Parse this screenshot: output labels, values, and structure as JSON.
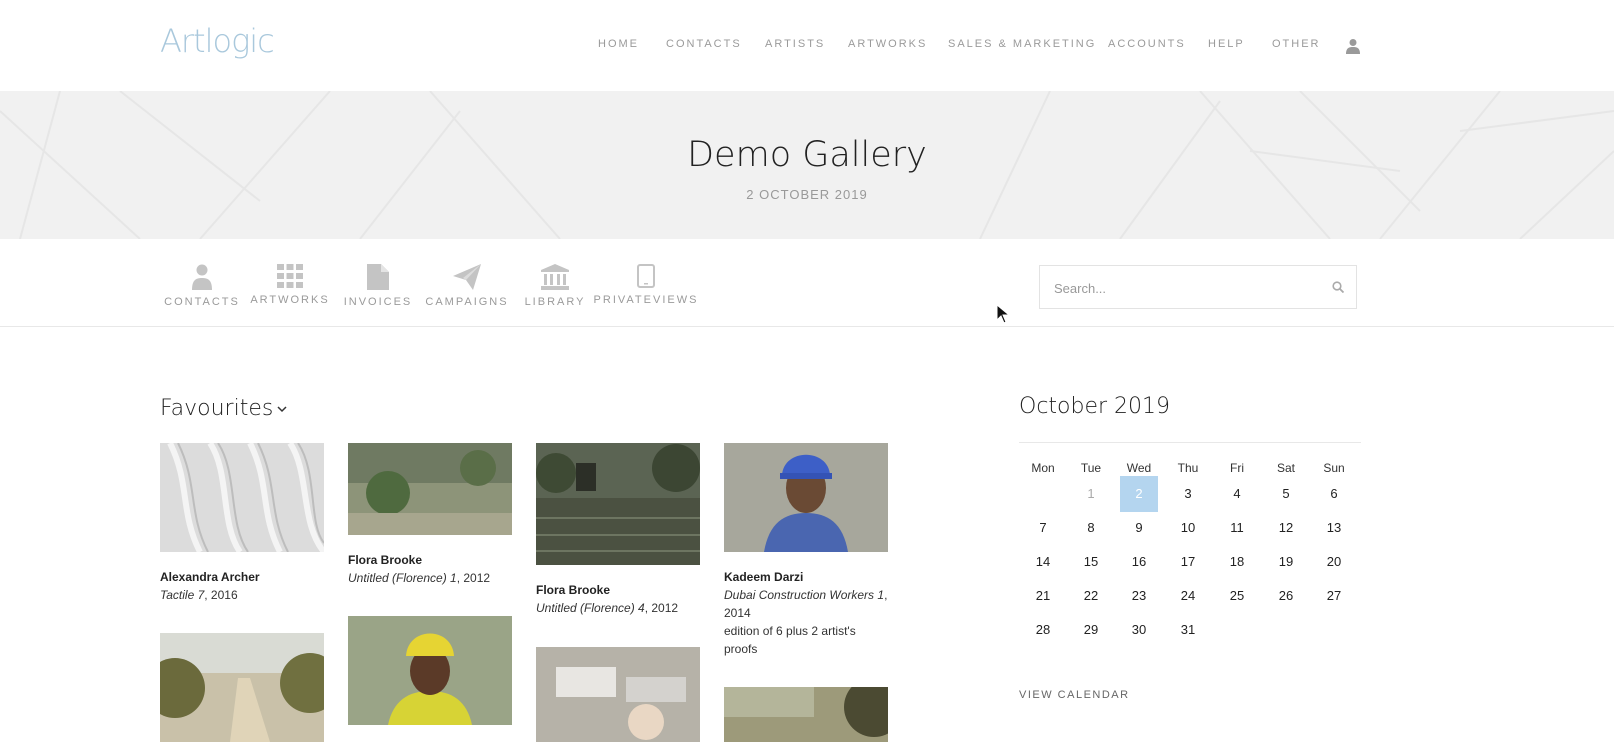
{
  "brand": {
    "logo": "Artlogic"
  },
  "nav": {
    "items": [
      "HOME",
      "CONTACTS",
      "ARTISTS",
      "ARTWORKS",
      "SALES & MARKETING",
      "ACCOUNTS",
      "HELP",
      "OTHER"
    ],
    "user_icon": "user-icon"
  },
  "banner": {
    "title": "Demo Gallery",
    "date": "2 OCTOBER 2019"
  },
  "quick_links": [
    {
      "label": "CONTACTS",
      "icon": "person-icon"
    },
    {
      "label": "ARTWORKS",
      "icon": "grid-icon"
    },
    {
      "label": "INVOICES",
      "icon": "document-icon"
    },
    {
      "label": "CAMPAIGNS",
      "icon": "paper-plane-icon"
    },
    {
      "label": "LIBRARY",
      "icon": "bank-icon"
    },
    {
      "label": "PRIVATEVIEWS",
      "icon": "tablet-icon"
    }
  ],
  "search": {
    "placeholder": "Search...",
    "value": ""
  },
  "favourites": {
    "title": "Favourites",
    "items": [
      {
        "artist": "Alexandra Archer",
        "title": "Tactile 7",
        "year": ", 2016",
        "note": ""
      },
      {
        "artist": "Flora Brooke",
        "title": "Untitled (Florence) 1",
        "year": ", 2012",
        "note": ""
      },
      {
        "artist": "Flora Brooke",
        "title": "Untitled (Florence) 4",
        "year": ", 2012",
        "note": ""
      },
      {
        "artist": "Kadeem Darzi",
        "title": "Dubai Construction Workers 1",
        "year": ", 2014",
        "note": "edition of 6 plus 2 artist's proofs"
      }
    ]
  },
  "calendar": {
    "title": "October 2019",
    "weekdays": [
      "Mon",
      "Tue",
      "Wed",
      "Thu",
      "Fri",
      "Sat",
      "Sun"
    ],
    "days": [
      "1",
      "2",
      "3",
      "4",
      "5",
      "6",
      "7",
      "8",
      "9",
      "10",
      "11",
      "12",
      "13",
      "14",
      "15",
      "16",
      "17",
      "18",
      "19",
      "20",
      "21",
      "22",
      "23",
      "24",
      "25",
      "26",
      "27",
      "28",
      "29",
      "30",
      "31"
    ],
    "today": "2",
    "past_day": "1",
    "view_label": "VIEW CALENDAR"
  },
  "colors": {
    "accent": "#b4d5ef",
    "logo": "#a9c8dc",
    "muted_text": "#9a9a9a"
  }
}
